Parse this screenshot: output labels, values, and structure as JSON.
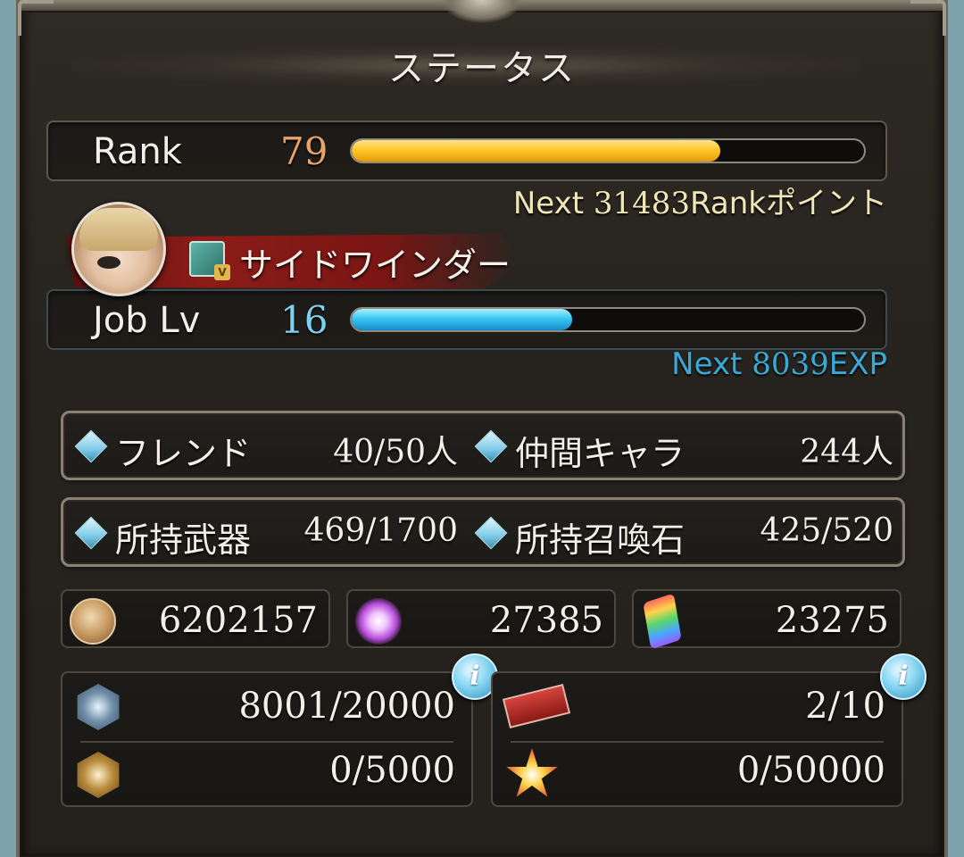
{
  "header": {
    "title": "ステータス"
  },
  "rank": {
    "label": "Rank",
    "value": "79",
    "progress": 0.72,
    "next_prefix": "Next ",
    "next_value": "31483",
    "next_suffix": "Rankポイント",
    "value_color": "#e8a36a",
    "next_color": "#f0e6b8"
  },
  "job": {
    "class_name": "サイドワインダー",
    "label": "Job Lv",
    "value": "16",
    "progress": 0.43,
    "next_prefix": "Next ",
    "next_value": "8039",
    "next_suffix": "EXP",
    "value_color": "#7fd0f2",
    "next_color": "#3aa9d6"
  },
  "stats_row1": {
    "friends_label": "フレンド",
    "friends_value": "40/50人",
    "crew_label": "仲間キャラ",
    "crew_value": "244人"
  },
  "stats_row2": {
    "weapons_label": "所持武器",
    "weapons_value": "469/1700",
    "summons_label": "所持召喚石",
    "summons_value": "425/520"
  },
  "currencies": {
    "rupie": "6202157",
    "crystal": "27385",
    "prism": "23275"
  },
  "bottom_left": {
    "top_value": "8001/20000",
    "bottom_value": "0/5000"
  },
  "bottom_right": {
    "top_value": "2/10",
    "bottom_value": "0/50000"
  },
  "info_glyph": "i"
}
